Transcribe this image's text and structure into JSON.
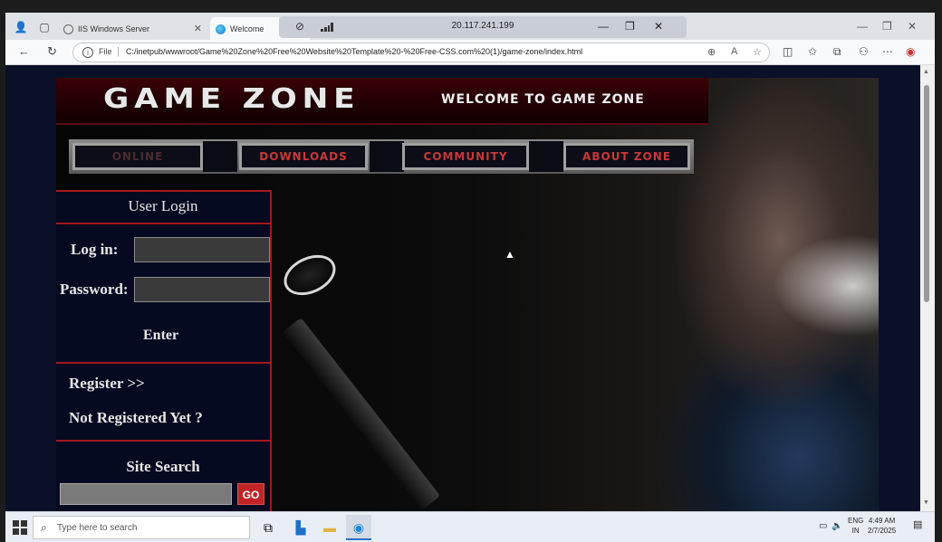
{
  "browser": {
    "tabs": [
      {
        "label": "IIS Windows Server",
        "active": false
      },
      {
        "label": "Welcome",
        "active": true
      }
    ],
    "rdp_address": "20.117.241.199",
    "address_prefix": "File",
    "url": "C:/inetpub/wwwroot/Game%20Zone%20Free%20Website%20Template%20-%20Free-CSS.com%20(1)/game-zone/index.html"
  },
  "site": {
    "logo": "GAME ZONE",
    "welcome": "WELCOME TO GAME ZONE",
    "nav": [
      {
        "label": "ONLINE",
        "dim": true
      },
      {
        "label": "DOWNLOADS",
        "dim": false
      },
      {
        "label": "COMMUNITY",
        "dim": false
      },
      {
        "label": "ABOUT ZONE",
        "dim": false
      }
    ],
    "login": {
      "title": "User Login",
      "login_label": "Log in:",
      "password_label": "Password:",
      "enter": "Enter"
    },
    "register": {
      "register_link": "Register >>",
      "not_registered": "Not Registered Yet ?"
    },
    "search": {
      "title": "Site Search",
      "go": "GO"
    }
  },
  "taskbar": {
    "search_placeholder": "Type here to search",
    "lang_top": "ENG",
    "lang_bottom": "IN",
    "time": "4:49 AM",
    "date": "2/7/2025"
  },
  "colors": {
    "accent_red": "#a4181c",
    "panel_bg": "#050a20",
    "nav_text": "#c83838"
  }
}
